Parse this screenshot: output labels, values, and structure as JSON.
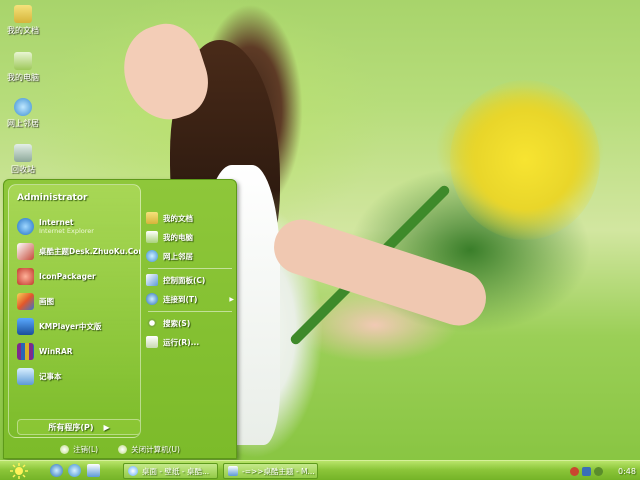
{
  "desktop_icons": [
    {
      "label": "我的文档",
      "icon": "folder-icon"
    },
    {
      "label": "我的电脑",
      "icon": "computer-icon"
    },
    {
      "label": "网上邻居",
      "icon": "network-icon"
    },
    {
      "label": "回收站",
      "icon": "recycle-bin-icon"
    }
  ],
  "start_menu": {
    "user": "Administrator",
    "programs": [
      {
        "title": "Internet",
        "subtitle": "Internet Explorer",
        "icon": "internet-explorer-icon"
      },
      {
        "title": "桌酷主题Desk.ZhuoKu.Com",
        "subtitle": "",
        "icon": "zhuoku-theme-icon"
      },
      {
        "title": "IconPackager",
        "subtitle": "",
        "icon": "iconpackager-icon"
      },
      {
        "title": "画图",
        "subtitle": "",
        "icon": "paint-icon"
      },
      {
        "title": "KMPlayer中文版",
        "subtitle": "",
        "icon": "kmplayer-icon"
      },
      {
        "title": "WinRAR",
        "subtitle": "",
        "icon": "winrar-icon"
      },
      {
        "title": "记事本",
        "subtitle": "",
        "icon": "notepad-icon"
      }
    ],
    "all_programs": "所有程序(P)",
    "right_items": [
      {
        "label": "我的文档",
        "icon": "folder-icon"
      },
      {
        "label": "我的电脑",
        "icon": "computer-icon"
      },
      {
        "label": "网上邻居",
        "icon": "network-icon"
      },
      {
        "label": "控制面板(C)",
        "icon": "control-panel-icon"
      },
      {
        "label": "连接到(T)",
        "icon": "connect-icon"
      },
      {
        "label": "搜索(S)",
        "icon": "search-icon"
      },
      {
        "label": "运行(R)...",
        "icon": "run-icon"
      }
    ],
    "logoff": "注销(L)",
    "shutdown": "关闭计算机(U)"
  },
  "taskbar": {
    "tasks": [
      {
        "label": "桌面 - 壁纸 - 桌酷...",
        "icon": "browser-icon"
      },
      {
        "label": "-=>>桌酷主题 - M...",
        "icon": "window-icon"
      }
    ],
    "clock": "0:48"
  },
  "colors": {
    "menu_green": "#7cbb2a",
    "taskbar_green": "#8cc63a",
    "flowers_yellow": "#f7e431"
  }
}
